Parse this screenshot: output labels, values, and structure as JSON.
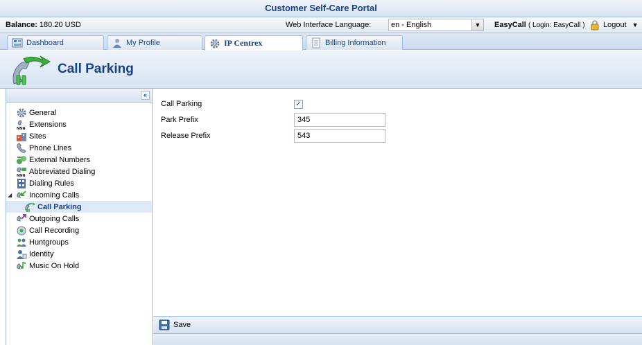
{
  "app": {
    "title": "Customer Self-Care Portal"
  },
  "status": {
    "balance_label": "Balance:",
    "balance_value": "180.20 USD",
    "language_label": "Web Interface Language:",
    "language_value": "en - English",
    "user_name": "EasyCall",
    "login_text": "( Login: EasyCall )",
    "logout_label": "Logout"
  },
  "tabs": [
    {
      "label": "Dashboard",
      "icon": "dashboard-icon"
    },
    {
      "label": "My Profile",
      "icon": "user-icon"
    },
    {
      "label": "IP Centrex",
      "icon": "gear-icon"
    },
    {
      "label": "Billing Information",
      "icon": "document-icon"
    }
  ],
  "page": {
    "title": "Call Parking"
  },
  "sidebar": {
    "items": [
      {
        "label": "General",
        "icon": "gear-icon"
      },
      {
        "label": "Extensions",
        "icon": "extensions-icon"
      },
      {
        "label": "Sites",
        "icon": "sites-icon"
      },
      {
        "label": "Phone Lines",
        "icon": "phone-lines-icon"
      },
      {
        "label": "External Numbers",
        "icon": "external-numbers-icon"
      },
      {
        "label": "Abbreviated Dialing",
        "icon": "abbreviated-dialing-icon"
      },
      {
        "label": "Dialing Rules",
        "icon": "dialing-rules-icon"
      },
      {
        "label": "Incoming Calls",
        "icon": "incoming-calls-icon"
      },
      {
        "label": "Call Parking",
        "icon": "call-parking-icon"
      },
      {
        "label": "Outgoing Calls",
        "icon": "outgoing-calls-icon"
      },
      {
        "label": "Call Recording",
        "icon": "call-recording-icon"
      },
      {
        "label": "Huntgroups",
        "icon": "huntgroups-icon"
      },
      {
        "label": "Identity",
        "icon": "identity-icon"
      },
      {
        "label": "Music On Hold",
        "icon": "music-on-hold-icon"
      }
    ]
  },
  "form": {
    "call_parking_label": "Call Parking",
    "call_parking_checked": true,
    "park_prefix_label": "Park Prefix",
    "park_prefix_value": "345",
    "release_prefix_label": "Release Prefix",
    "release_prefix_value": "543"
  },
  "toolbar": {
    "save_label": "Save"
  },
  "colors": {
    "accent": "#15428b",
    "border": "#99bbe8",
    "selected": "#dfe8f6"
  }
}
